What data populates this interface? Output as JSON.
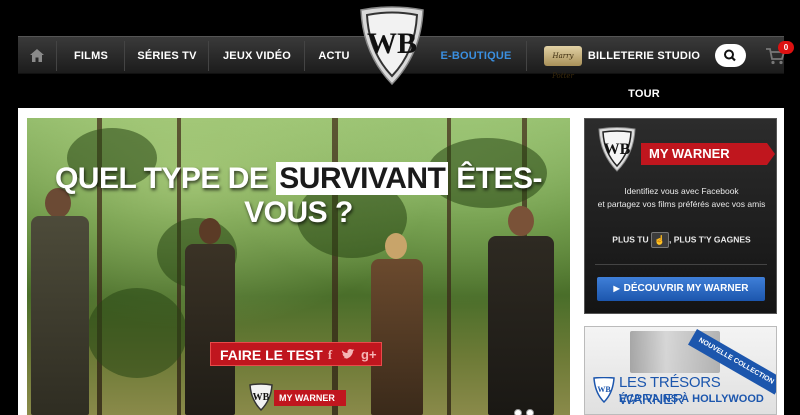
{
  "nav": {
    "items": [
      {
        "label": "Films"
      },
      {
        "label": "Séries TV"
      },
      {
        "label": "Jeux Vidéo"
      },
      {
        "label": "Actu"
      },
      {
        "label": "E-Boutique"
      },
      {
        "label": "Billeterie Studio Tour"
      }
    ],
    "hp_badge": "Harry Potter",
    "cart_count": "0",
    "accent_color": "#3a8fe0"
  },
  "hero": {
    "title_before": "QUEL TYPE DE ",
    "title_highlight": "SURVIVANT",
    "title_after": " ÊTES-VOUS ?",
    "cta_label": "FAIRE LE TEST",
    "social_icons": [
      "facebook-icon",
      "twitter-icon",
      "google-plus-icon"
    ],
    "brand_label": "MY WARNER"
  },
  "my_warner_panel": {
    "title": "MY WARNER",
    "line1": "Identifiez vous avec Facebook",
    "line2": "et partagez vos films préférés avec vos amis",
    "like_before": "PLUS TU",
    "like_after": ", PLUS T'Y GAGNES",
    "button_label": "DÉCOUVRIR MY WARNER",
    "brand_color": "#c0161e"
  },
  "promo": {
    "banner": "NOUVELLE COLLECTION",
    "line1": "LES TRÉSORS WARNER",
    "line2": "ÉCRIVAINS À HOLLYWOOD"
  }
}
